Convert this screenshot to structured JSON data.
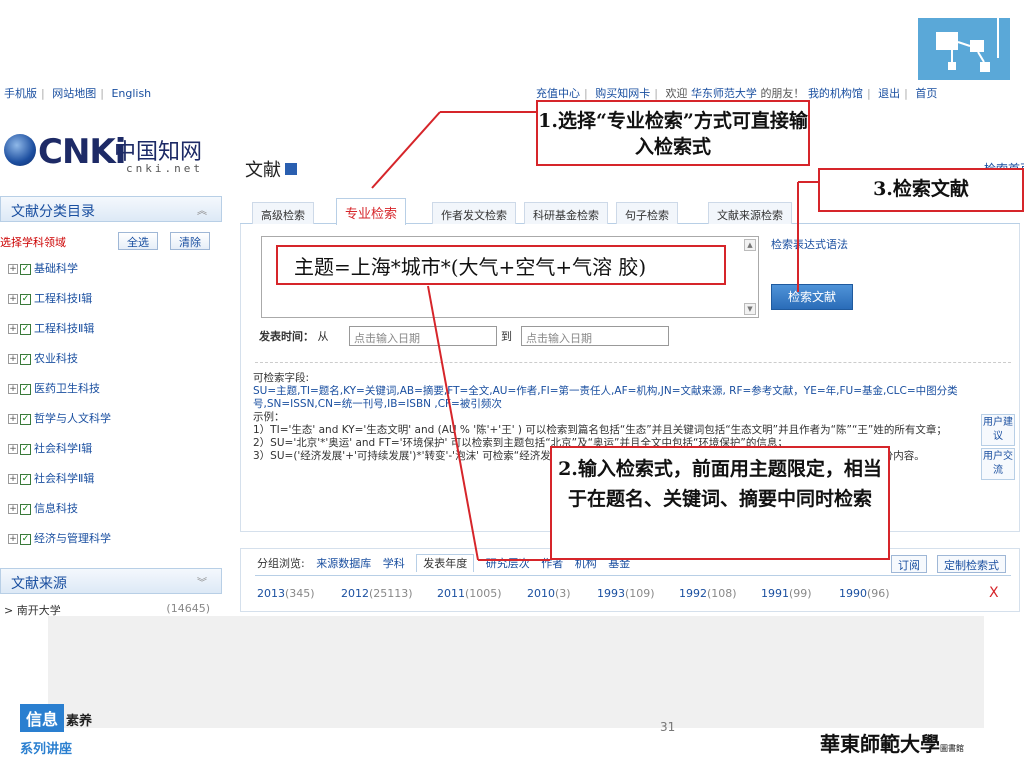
{
  "topbar": {
    "left_links": [
      "手机版",
      "网站地图",
      "English"
    ],
    "right_links": [
      "充值中心",
      "购买知网卡",
      "欢迎",
      "华东师范大学",
      "的朋友！",
      "我的机构馆",
      "退出",
      "首页"
    ]
  },
  "brand": {
    "cnki": "CNKi",
    "cn_name": "中国知网",
    "domain": "cnki.net"
  },
  "section_title": "文献",
  "home_link": "检索首页",
  "sidebar": {
    "category_title": "文献分类目录",
    "select_label": "选择学科领域",
    "select_all": "全选",
    "clear": "清除",
    "categories": [
      "基础科学",
      "工程科技Ⅰ辑",
      "工程科技Ⅱ辑",
      "农业科技",
      "医药卫生科技",
      "哲学与人文科学",
      "社会科学Ⅰ辑",
      "社会科学Ⅱ辑",
      "信息科技",
      "经济与管理科学"
    ],
    "source_title": "文献来源",
    "source_item": "> 南开大学",
    "source_count": "(14645)"
  },
  "tabs": [
    "高级检索",
    "专业检索",
    "作者发文检索",
    "科研基金检索",
    "句子检索",
    "文献来源检索"
  ],
  "search": {
    "syntax_link": "检索表达式语法",
    "button": "检索文献",
    "date_label": "发表时间：",
    "date_from": "从",
    "date_to": "到",
    "date_placeholder": "点击输入日期"
  },
  "help": {
    "heading": "可检索字段:",
    "fields": "SU=主题,TI=题名,KY=关键词,AB=摘要,FT=全文,AU=作者,FI=第一责任人,AF=机构,JN=文献来源, RF=参考文献，YE=年,FU=基金,CLC=中图分类号,SN=ISSN,CN=统一刊号,IB=ISBN ,CF=被引频次",
    "example_title": "示例：",
    "ex1": "1）TI='生态' and KY='生态文明' and (AU % '陈'+'王' ) 可以检索到篇名包括“生态”并且关键词包括“生态文明”并且作者为“陈”“王”姓的所有文章；",
    "ex2": "2）SU='北京'*'奥运' and FT='环境保护' 可以检索到主题包括“北京”及“奥运”并且全文中包括“环境保护”的信息；",
    "ex3": "3）SU=('经济发展'+'可持续发展')*'转变'-'泡沫' 可检索“经济发展”或“可持续发展”有关“转变”的信息，并且可以去除与“泡沫”有关的部分内容。"
  },
  "side_tabs": [
    "用户建议",
    "用户交流"
  ],
  "browse": {
    "label": "分组浏览:",
    "groups": [
      "来源数据库",
      "学科",
      "发表年度",
      "研究层次",
      "作者",
      "机构",
      "基金"
    ],
    "subscribe": "订阅",
    "custom": "定制检索式",
    "years": [
      {
        "year": "2013",
        "count": "(345)"
      },
      {
        "year": "2012",
        "count": "(25113)"
      },
      {
        "year": "2011",
        "count": "(1005)"
      },
      {
        "year": "2010",
        "count": "(3)"
      },
      {
        "year": "1993",
        "count": "(109)"
      },
      {
        "year": "1992",
        "count": "(108)"
      },
      {
        "year": "1991",
        "count": "(99)"
      },
      {
        "year": "1990",
        "count": "(96)"
      }
    ],
    "close": "X"
  },
  "annotations": {
    "step1": "1.选择“专业检索”方式可直接输入检索式",
    "step2": "2.输入检索式，前面用主题限定，相当于在题名、关键词、摘要中同时检索",
    "step3": "3.检索文献",
    "expression": "主题=上海*城市*(大气+空气+气溶 胶)"
  },
  "footer": {
    "badge": "信息",
    "badge_suffix": "素养",
    "series": "系列讲座",
    "page": "31",
    "university": "華東師範大學",
    "library": "圖書館"
  },
  "colors": {
    "accent_red": "#d6252a",
    "link_blue": "#1a4fa0",
    "button_blue": "#2a6cb8"
  }
}
